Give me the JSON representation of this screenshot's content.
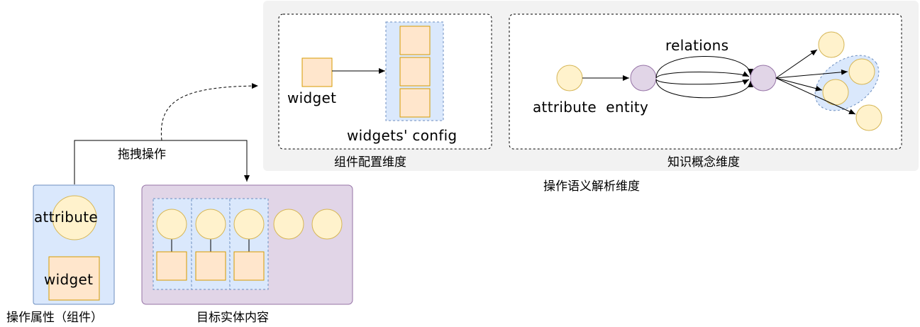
{
  "semantic_panel": {
    "caption": "操作语义解析维度",
    "widget_config_box": {
      "caption": "组件配置维度",
      "widget_label": "widget",
      "widgets_config_label": "widgets' config"
    },
    "knowledge_box": {
      "caption": "知识概念维度",
      "relations_label": "relations",
      "attribute_entity_label": "attribute  entity"
    }
  },
  "drag_label": "拖拽操作",
  "operation_attribute": {
    "caption": "操作属性（组件）",
    "attribute_label": "attribute",
    "widget_label": "widget"
  },
  "target_entity": {
    "caption": "目标实体内容"
  },
  "colors": {
    "panel_gray": "#f2f2f2",
    "blue_fill": "#dae8fc",
    "blue_stroke": "#6c8ebf",
    "purple_fill": "#e1d5e7",
    "purple_stroke": "#9673a6",
    "yellow_fill": "#fff2cc",
    "yellow_stroke": "#d6b656",
    "orange_fill": "#ffe6cc",
    "orange_stroke": "#d79b00"
  }
}
